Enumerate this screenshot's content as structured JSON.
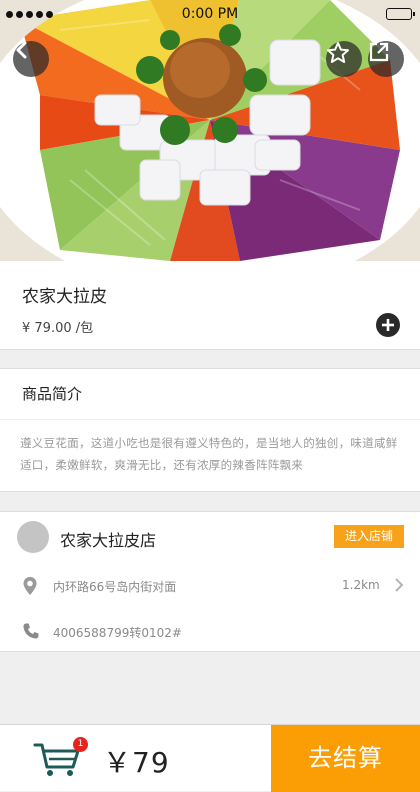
{
  "status_bar": {
    "time": "0:00 PM"
  },
  "hero": {
    "image": "cold-noodle-salad-platter"
  },
  "product": {
    "name": "农家大拉皮",
    "price": "¥ 79.00  /包"
  },
  "intro": {
    "title": "商品简介",
    "description": "遵义豆花面，这道小吃也是很有遵义特色的，是当地人的独创，味道咸鲜适口，柔嫩鲜软，爽滑无比，还有浓厚的辣香阵阵飘来"
  },
  "shop": {
    "name": "农家大拉皮店",
    "enter_label": "进入店铺",
    "address": "内环路66号岛内街对面",
    "distance": "1.2km",
    "phone": "4006588799转0102#"
  },
  "cart": {
    "badge": "1",
    "total": "￥79",
    "checkout_label": "去结算"
  },
  "colors": {
    "accent": "#fb9e05",
    "badge": "#e8231d",
    "enter_button": "#f7a21b"
  }
}
